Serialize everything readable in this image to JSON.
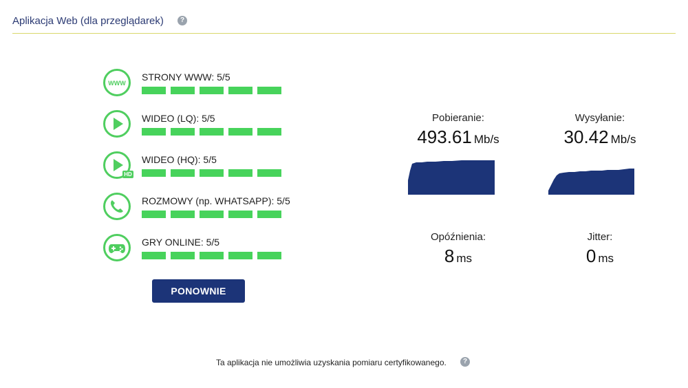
{
  "header": {
    "title": "Aplikacja Web (dla przeglądarek)",
    "help_icon": "question-circle-icon"
  },
  "categories": [
    {
      "id": "www",
      "icon": "www-icon",
      "label": "STRONY WWW: 5/5",
      "score": 5,
      "max": 5,
      "icon_text": "WWW"
    },
    {
      "id": "video-lq",
      "icon": "play-icon",
      "label": "WIDEO (LQ): 5/5",
      "score": 5,
      "max": 5
    },
    {
      "id": "video-hq",
      "icon": "play-hd-icon",
      "label": "WIDEO (HQ): 5/5",
      "score": 5,
      "max": 5,
      "badge": "HD"
    },
    {
      "id": "calls",
      "icon": "phone-icon",
      "label": "ROZMOWY (np. WHATSAPP): 5/5",
      "score": 5,
      "max": 5
    },
    {
      "id": "games",
      "icon": "gamepad-icon",
      "label": "GRY ONLINE: 5/5",
      "score": 5,
      "max": 5
    }
  ],
  "button": {
    "retry_label": "PONOWNIE"
  },
  "metrics": {
    "download": {
      "label": "Pobieranie:",
      "value": "493.61",
      "unit": "Mb/s"
    },
    "upload": {
      "label": "Wysyłanie:",
      "value": "30.42",
      "unit": "Mb/s"
    },
    "latency": {
      "label": "Opóźnienia:",
      "value": "8",
      "unit": "ms"
    },
    "jitter": {
      "label": "Jitter:",
      "value": "0",
      "unit": "ms"
    }
  },
  "footer": {
    "note": "Ta aplikacja nie umożliwia uzyskania pomiaru certyfikowanego.",
    "help_icon": "question-circle-icon"
  },
  "colors": {
    "accent_green": "#47d35b",
    "navy": "#1c3478",
    "header_text": "#2b3a73",
    "divider": "#d9d86a"
  }
}
